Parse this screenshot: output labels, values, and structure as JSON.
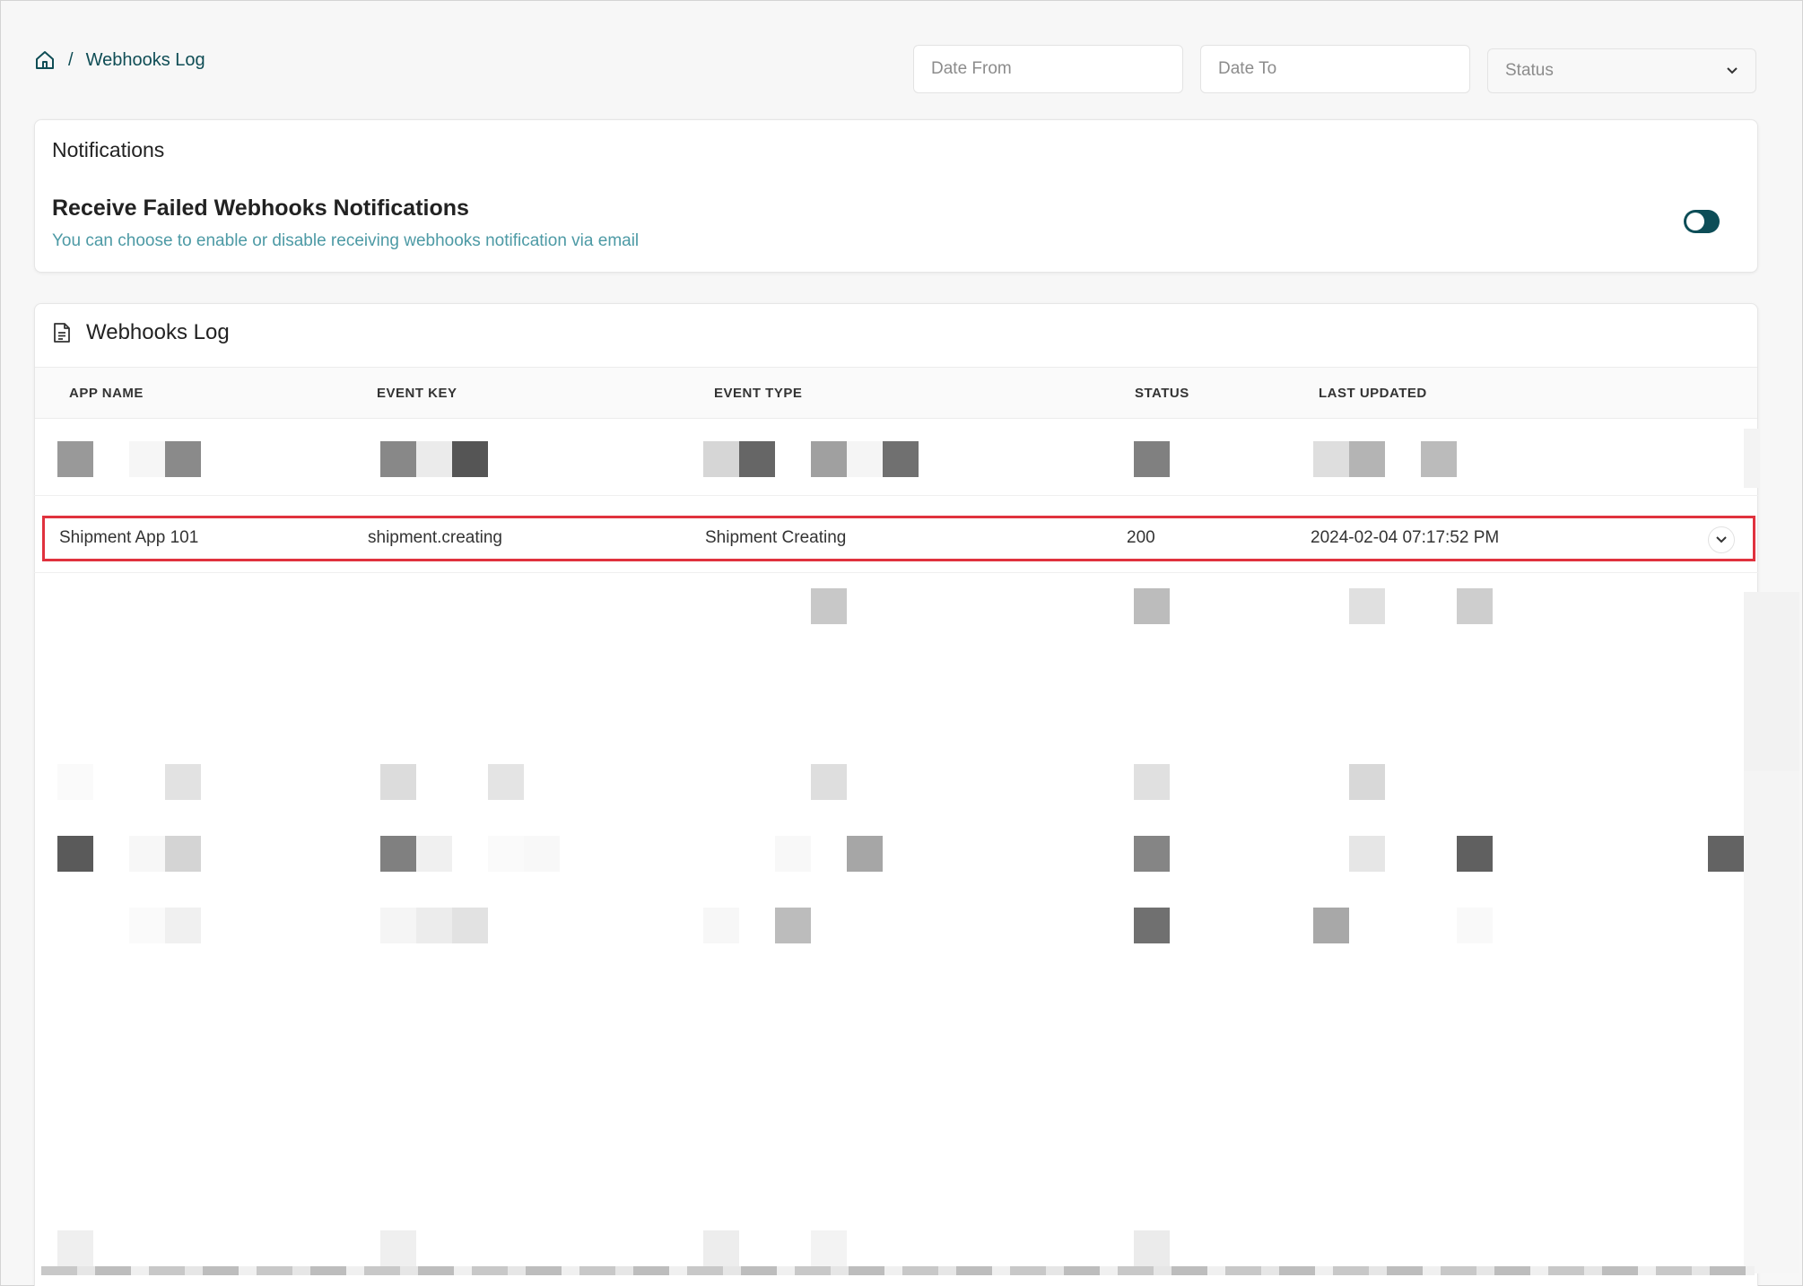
{
  "breadcrumb": {
    "home_icon": "home-icon",
    "separator": "/",
    "current": "Webhooks Log"
  },
  "filters": {
    "date_from_placeholder": "Date From",
    "date_to_placeholder": "Date To",
    "status_placeholder": "Status"
  },
  "notifications": {
    "title": "Notifications",
    "heading": "Receive Failed Webhooks Notifications",
    "description": "You can choose to enable or disable receiving webhooks notification via email",
    "toggle_enabled": false
  },
  "log": {
    "title": "Webhooks Log",
    "columns": [
      "APP NAME",
      "EVENT KEY",
      "EVENT TYPE",
      "STATUS",
      "LAST UPDATED"
    ],
    "highlighted_row": {
      "app_name": "Shipment App 101",
      "event_key": "shipment.creating",
      "event_type": "Shipment Creating",
      "status": "200",
      "last_updated": "2024-02-04 07:17:52 PM"
    }
  },
  "colors": {
    "accent": "#0d4d57",
    "link": "#0f4d55",
    "description": "#4d9aa5",
    "highlight_border": "#e0323e"
  }
}
